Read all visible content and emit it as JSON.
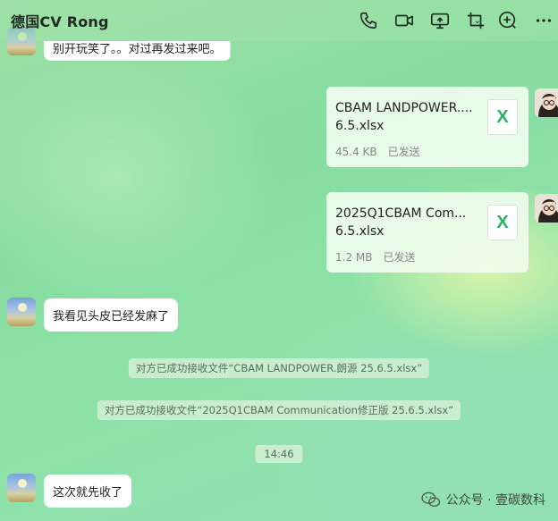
{
  "header": {
    "title": "德国CV Rong",
    "icons": [
      "phone-icon",
      "video-call-icon",
      "screen-share-icon",
      "screenshot-icon",
      "add-icon",
      "more-icon"
    ]
  },
  "messages": {
    "top_partial": "别开玩笑了。。对过再发过来吧。",
    "file1": {
      "name_line1": "CBAM LANDPOWER....",
      "name_line2": "6.5.xlsx",
      "size": "45.4 KB",
      "status": "已发送",
      "icon": "X"
    },
    "file2": {
      "name_line1": "2025Q1CBAM Com...",
      "name_line2": "6.5.xlsx",
      "size": "1.2 MB",
      "status": "已发送",
      "icon": "X"
    },
    "reply1": "我看见头皮已经发麻了",
    "sys1": "对方已成功接收文件“CBAM LANDPOWER.朗源 25.6.5.xlsx”",
    "sys2": "对方已成功接收文件“2025Q1CBAM Communication修正版 25.6.5.xlsx”",
    "time": "14:46",
    "reply2": "这次就先收了"
  },
  "watermark": {
    "text": "公众号 · 壹碳数科"
  }
}
